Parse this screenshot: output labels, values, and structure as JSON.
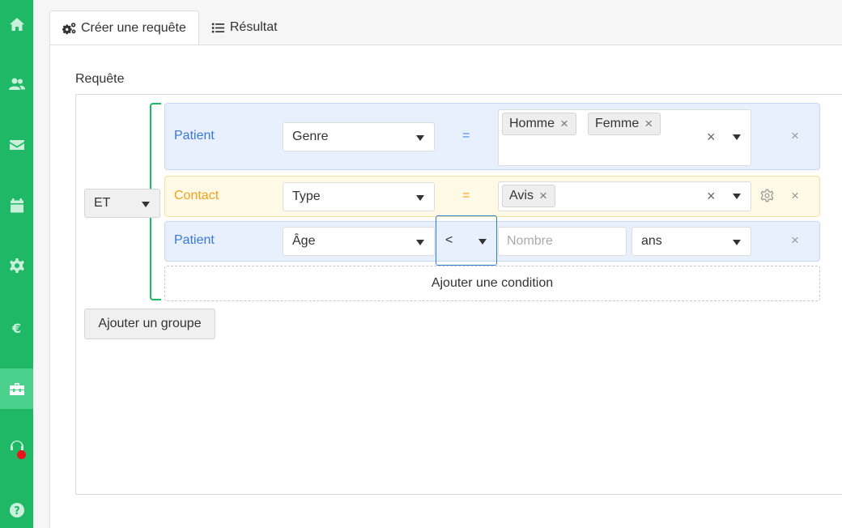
{
  "sidebar": {
    "items": [
      {
        "name": "home",
        "icon": "home-icon"
      },
      {
        "name": "users",
        "icon": "users-icon"
      },
      {
        "name": "mail",
        "icon": "envelope-icon"
      },
      {
        "name": "calendar",
        "icon": "calendar-icon"
      },
      {
        "name": "settings",
        "icon": "gear-icon"
      },
      {
        "name": "billing",
        "icon": "euro-icon"
      },
      {
        "name": "tools",
        "icon": "toolbox-icon",
        "active": true
      },
      {
        "name": "support",
        "icon": "headset-icon",
        "notification": true
      },
      {
        "name": "help",
        "icon": "question-icon"
      }
    ],
    "accent": "#1fb866",
    "notification_color": "#e8141b"
  },
  "tabs": [
    {
      "label": "Créer une requête",
      "icon": "cogs-icon",
      "active": true
    },
    {
      "label": "Résultat",
      "icon": "list-icon",
      "active": false
    }
  ],
  "query": {
    "section_label": "Requête",
    "group_operator": "ET",
    "rules": [
      {
        "entity": "Patient",
        "field": "Genre",
        "operator": "=",
        "values": [
          "Homme",
          "Femme"
        ]
      },
      {
        "entity": "Contact",
        "field": "Type",
        "operator": "=",
        "values": [
          "Avis"
        ]
      },
      {
        "entity": "Patient",
        "field": "Âge",
        "operator": "<",
        "value_placeholder": "Nombre",
        "unit": "ans"
      }
    ],
    "add_condition_label": "Ajouter une condition",
    "add_group_label": "Ajouter un groupe",
    "remove_symbol": "×"
  }
}
